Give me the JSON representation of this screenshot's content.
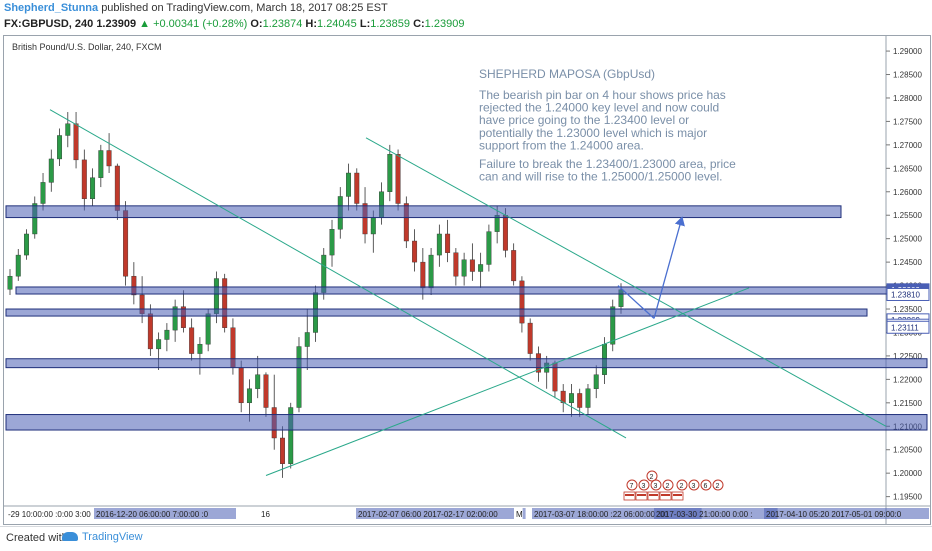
{
  "header": {
    "author": "Shepherd_Stunna",
    "published": "published on TradingView.com, March 18, 2017 08:25 EST",
    "symbol": "FX:GBPUSD, 240",
    "last": "1.23909",
    "change": "▲ +0.00341 (+0.28%)",
    "o_label": "O:",
    "o_val": "1.23874",
    "h_label": "H:",
    "h_val": "1.24045",
    "l_label": "L:",
    "l_val": "1.23859",
    "c_label": "C:",
    "c_val": "1.23909"
  },
  "footer": {
    "created_with": "Created with",
    "brand": "TradingView"
  },
  "chart_data": {
    "type": "candlestick",
    "title": "British Pound/U.S. Dollar, 240, FXCM",
    "ylim": [
      1.193,
      1.293
    ],
    "y_ticks": [
      1.195,
      1.2,
      1.205,
      1.21,
      1.215,
      1.22,
      1.225,
      1.23,
      1.235,
      1.24,
      1.245,
      1.25,
      1.255,
      1.26,
      1.265,
      1.27,
      1.275,
      1.28,
      1.285,
      1.29
    ],
    "x_labels": [
      "-29 10:00:00 :0:00 3:00",
      "2016-12-20 06:00:00 7:00:00 :0",
      "16",
      "2017-02-07 06:00 2017-02-17 02:00:00",
      "M",
      "2017-03-07 18:00:00 :22 06:00:00 :00",
      "2017-03-30 21:00:00 0:00 :",
      "2017-04-10 05:20 2017-05-01 09:00:0"
    ],
    "price_tags": [
      {
        "label": "1.23909",
        "value": 1.23909,
        "highlight": true
      },
      {
        "label": "1.23810",
        "value": 1.2381,
        "highlight": false
      },
      {
        "label": "1.23269",
        "value": 1.23269,
        "highlight": false
      },
      {
        "label": "1.23155",
        "value": 1.23155,
        "highlight": false
      },
      {
        "label": "1.23111",
        "value": 1.23111,
        "highlight": false
      }
    ],
    "zones": [
      {
        "name": "zone-1-2555",
        "ymin": 1.2545,
        "ymax": 1.257
      },
      {
        "name": "zone-2-2390",
        "ymin": 1.2382,
        "ymax": 1.2397
      },
      {
        "name": "zone-3-2340",
        "ymin": 1.2335,
        "ymax": 1.235
      },
      {
        "name": "zone-4-2230",
        "ymin": 1.2225,
        "ymax": 1.2244
      },
      {
        "name": "zone-5-2115",
        "ymin": 1.2092,
        "ymax": 1.2125
      }
    ],
    "annotation": {
      "title": "SHEPHERD MAPOSA (GbpUsd)",
      "body": [
        "The bearish pin bar on 4 hour shows price has",
        "rejected the 1.24000 key level and now could",
        "have price going to the 1.23400 level or",
        "potentially the 1.23000 level which is major",
        "support from the 1.24000 area."
      ],
      "body2": [
        "Failure to break the 1.23400/1.23000 area, price",
        "can and will rise to the 1.25000/1.25000 level."
      ]
    },
    "event_markers": [
      "2",
      "7",
      "3",
      "3",
      "2",
      "2",
      "3",
      "6",
      "2"
    ],
    "candles": [
      [
        1.2392,
        1.2435,
        1.238,
        1.242
      ],
      [
        1.242,
        1.2478,
        1.241,
        1.2465
      ],
      [
        1.2465,
        1.252,
        1.2455,
        1.251
      ],
      [
        1.251,
        1.259,
        1.25,
        1.2575
      ],
      [
        1.2575,
        1.264,
        1.256,
        1.262
      ],
      [
        1.262,
        1.269,
        1.26,
        1.267
      ],
      [
        1.267,
        1.2735,
        1.2655,
        1.272
      ],
      [
        1.272,
        1.277,
        1.2695,
        1.2745
      ],
      [
        1.2745,
        1.277,
        1.265,
        1.2668
      ],
      [
        1.2668,
        1.269,
        1.256,
        1.2585
      ],
      [
        1.2585,
        1.265,
        1.257,
        1.263
      ],
      [
        1.263,
        1.27,
        1.261,
        1.2688
      ],
      [
        1.2688,
        1.2725,
        1.264,
        1.2655
      ],
      [
        1.2655,
        1.266,
        1.254,
        1.256
      ],
      [
        1.256,
        1.258,
        1.24,
        1.242
      ],
      [
        1.242,
        1.245,
        1.236,
        1.238
      ],
      [
        1.238,
        1.242,
        1.232,
        1.234
      ],
      [
        1.234,
        1.236,
        1.225,
        1.2265
      ],
      [
        1.2265,
        1.23,
        1.222,
        1.2285
      ],
      [
        1.2285,
        1.232,
        1.226,
        1.2305
      ],
      [
        1.2305,
        1.237,
        1.228,
        1.2355
      ],
      [
        1.2355,
        1.239,
        1.23,
        1.231
      ],
      [
        1.231,
        1.233,
        1.224,
        1.2255
      ],
      [
        1.2255,
        1.229,
        1.221,
        1.2275
      ],
      [
        1.2275,
        1.235,
        1.226,
        1.234
      ],
      [
        1.234,
        1.243,
        1.232,
        1.2415
      ],
      [
        1.2415,
        1.2425,
        1.23,
        1.231
      ],
      [
        1.231,
        1.233,
        1.221,
        1.2225
      ],
      [
        1.2225,
        1.224,
        1.213,
        1.215
      ],
      [
        1.215,
        1.22,
        1.211,
        1.218
      ],
      [
        1.218,
        1.225,
        1.216,
        1.221
      ],
      [
        1.221,
        1.2215,
        1.212,
        1.214
      ],
      [
        1.214,
        1.221,
        1.205,
        1.2075
      ],
      [
        1.2075,
        1.21,
        1.199,
        1.202
      ],
      [
        1.202,
        1.215,
        1.201,
        1.214
      ],
      [
        1.214,
        1.229,
        1.213,
        1.227
      ],
      [
        1.227,
        1.235,
        1.222,
        1.23
      ],
      [
        1.23,
        1.24,
        1.228,
        1.2385
      ],
      [
        1.2385,
        1.248,
        1.237,
        1.2465
      ],
      [
        1.2465,
        1.254,
        1.244,
        1.252
      ],
      [
        1.252,
        1.261,
        1.25,
        1.259
      ],
      [
        1.259,
        1.266,
        1.256,
        1.264
      ],
      [
        1.264,
        1.265,
        1.256,
        1.2575
      ],
      [
        1.2575,
        1.261,
        1.249,
        1.251
      ],
      [
        1.251,
        1.256,
        1.247,
        1.2545
      ],
      [
        1.2545,
        1.262,
        1.253,
        1.26
      ],
      [
        1.26,
        1.27,
        1.258,
        1.268
      ],
      [
        1.268,
        1.269,
        1.256,
        1.2575
      ],
      [
        1.2575,
        1.259,
        1.248,
        1.2495
      ],
      [
        1.2495,
        1.252,
        1.243,
        1.245
      ],
      [
        1.245,
        1.248,
        1.237,
        1.2395
      ],
      [
        1.2395,
        1.248,
        1.238,
        1.2465
      ],
      [
        1.2465,
        1.253,
        1.244,
        1.251
      ],
      [
        1.251,
        1.254,
        1.245,
        1.247
      ],
      [
        1.247,
        1.248,
        1.24,
        1.242
      ],
      [
        1.242,
        1.247,
        1.24,
        1.2455
      ],
      [
        1.2455,
        1.249,
        1.241,
        1.243
      ],
      [
        1.243,
        1.247,
        1.2395,
        1.2445
      ],
      [
        1.2445,
        1.253,
        1.243,
        1.2515
      ],
      [
        1.2515,
        1.257,
        1.249,
        1.255
      ],
      [
        1.255,
        1.2565,
        1.246,
        1.2475
      ],
      [
        1.2475,
        1.249,
        1.24,
        1.241
      ],
      [
        1.241,
        1.242,
        1.23,
        1.232
      ],
      [
        1.232,
        1.233,
        1.224,
        1.2255
      ],
      [
        1.2255,
        1.227,
        1.2195,
        1.2215
      ],
      [
        1.2215,
        1.225,
        1.218,
        1.2235
      ],
      [
        1.2235,
        1.224,
        1.216,
        1.2175
      ],
      [
        1.2175,
        1.219,
        1.213,
        1.215
      ],
      [
        1.215,
        1.219,
        1.212,
        1.217
      ],
      [
        1.217,
        1.218,
        1.212,
        1.214
      ],
      [
        1.214,
        1.219,
        1.2125,
        1.218
      ],
      [
        1.218,
        1.223,
        1.216,
        1.221
      ],
      [
        1.221,
        1.229,
        1.219,
        1.2275
      ],
      [
        1.2275,
        1.237,
        1.226,
        1.2355
      ],
      [
        1.2355,
        1.2405,
        1.234,
        1.2391
      ]
    ]
  }
}
